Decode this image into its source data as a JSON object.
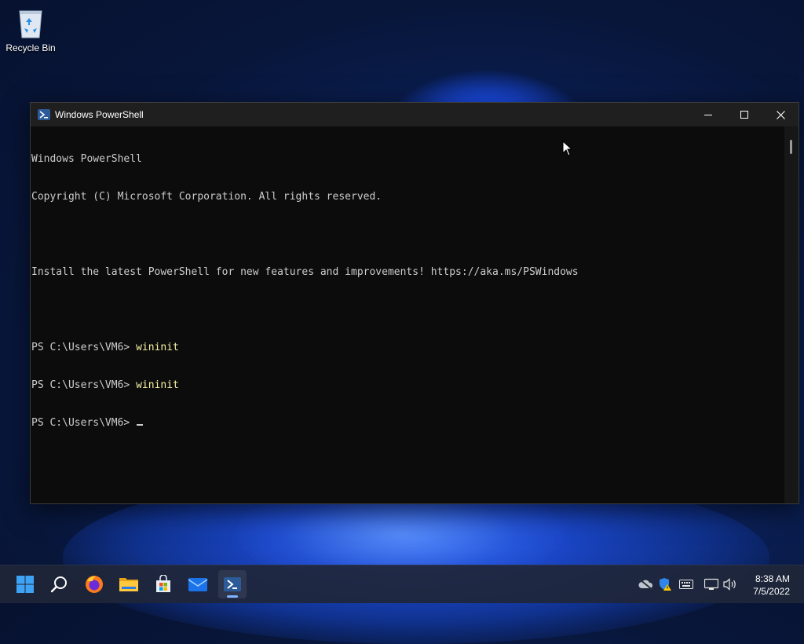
{
  "desktop": {
    "icons": [
      {
        "label": "Recycle Bin",
        "icon": "recycle-bin-icon"
      }
    ]
  },
  "window": {
    "title": "Windows PowerShell",
    "icon": "powershell-icon",
    "controls": {
      "minimize": "minimize-icon",
      "maximize": "maximize-icon",
      "close": "close-icon"
    }
  },
  "console": {
    "lines": [
      {
        "text": "Windows PowerShell"
      },
      {
        "text": "Copyright (C) Microsoft Corporation. All rights reserved."
      },
      {
        "text": ""
      },
      {
        "text": "Install the latest PowerShell for new features and improvements! https://aka.ms/PSWindows"
      },
      {
        "text": ""
      },
      {
        "prompt": "PS C:\\Users\\VM6> ",
        "command": "wininit"
      },
      {
        "prompt": "PS C:\\Users\\VM6> ",
        "command": "wininit"
      },
      {
        "prompt": "PS C:\\Users\\VM6> ",
        "command": ""
      }
    ],
    "colors": {
      "text": "#cccccc",
      "command": "#f9f1a5",
      "background": "#0c0c0c"
    }
  },
  "taskbar": {
    "apps": [
      {
        "name": "start",
        "icon": "windows-start-icon"
      },
      {
        "name": "search",
        "icon": "search-icon"
      },
      {
        "name": "firefox",
        "icon": "firefox-icon"
      },
      {
        "name": "file-explorer",
        "icon": "folder-icon"
      },
      {
        "name": "microsoft-store",
        "icon": "store-icon"
      },
      {
        "name": "mail",
        "icon": "mail-icon"
      },
      {
        "name": "powershell",
        "icon": "powershell-icon",
        "active": true
      }
    ],
    "tray": [
      "onedrive-icon",
      "security-warning-icon",
      "keyboard-icon",
      "network-icon",
      "volume-icon"
    ],
    "clock": {
      "time": "8:38 AM",
      "date": "7/5/2022"
    },
    "accent": "#7fb4ff"
  }
}
